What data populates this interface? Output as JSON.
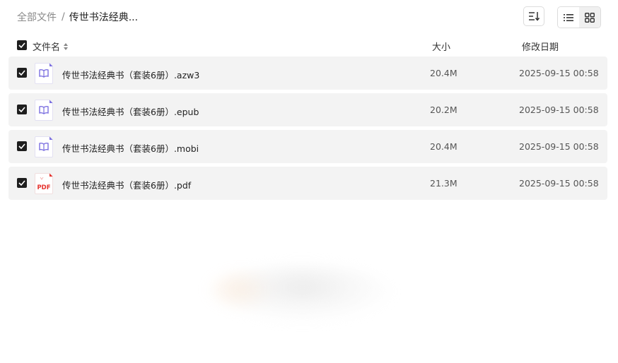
{
  "breadcrumb": {
    "root": "全部文件",
    "separator": "/",
    "current": "传世书法经典..."
  },
  "toolbar": {
    "sort_icon": "sort-icon",
    "view_list_icon": "list-view-icon",
    "view_grid_icon": "grid-view-icon",
    "active_view": "list"
  },
  "header": {
    "name": "文件名",
    "size": "大小",
    "date": "修改日期",
    "all_checked": true
  },
  "files": [
    {
      "name": "传世书法经典书（套装6册）.azw3",
      "size": "20.4M",
      "modified": "2025-09-15 00:58",
      "icon": "ebook-icon",
      "checked": true
    },
    {
      "name": "传世书法经典书（套装6册）.epub",
      "size": "20.2M",
      "modified": "2025-09-15 00:58",
      "icon": "ebook-icon",
      "checked": true
    },
    {
      "name": "传世书法经典书（套装6册）.mobi",
      "size": "20.4M",
      "modified": "2025-09-15 00:58",
      "icon": "ebook-icon",
      "checked": true
    },
    {
      "name": "传世书法经典书（套装6册）.pdf",
      "size": "21.3M",
      "modified": "2025-09-15 00:58",
      "icon": "pdf-icon",
      "icon_text": "PDF",
      "checked": true
    }
  ],
  "colors": {
    "ebook_accent": "#7b6fe0",
    "pdf_accent": "#e5322d",
    "row_bg": "#f3f3f3",
    "checkbox": "#1e1e1e"
  }
}
